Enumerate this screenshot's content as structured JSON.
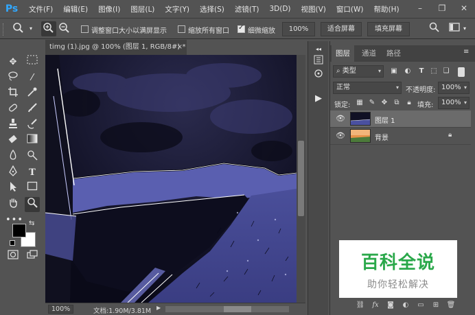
{
  "app": {
    "logo": "Ps"
  },
  "menu": [
    "文件(F)",
    "编辑(E)",
    "图像(I)",
    "图层(L)",
    "文字(Y)",
    "选择(S)",
    "滤镜(T)",
    "3D(D)",
    "视图(V)",
    "窗口(W)",
    "帮助(H)"
  ],
  "options": {
    "resize_windows_label": "调整窗口大小以满屏显示",
    "zoom_all_label": "缩放所有窗口",
    "scrubby_zoom_label": "细微缩放",
    "scrubby_zoom_checked": true,
    "zoom_value": "100%",
    "fit_screen_label": "适合屏幕",
    "fill_screen_label": "填充屏幕"
  },
  "document": {
    "tab_title": "timg (1).jpg @ 100% (图层 1, RGB/8#) *",
    "close_glyph": "×",
    "zoom": "100%",
    "doc_size": "文档:1.90M/3.81M"
  },
  "layers_panel": {
    "tabs": [
      "图层",
      "通道",
      "路径"
    ],
    "filter_kind": "类型",
    "blend_mode": "正常",
    "opacity_label": "不透明度:",
    "opacity_value": "100%",
    "lock_label": "锁定:",
    "fill_label": "填充:",
    "fill_value": "100%",
    "layers": [
      {
        "name": "图层 1",
        "selected": true,
        "locked": false
      },
      {
        "name": "背景",
        "selected": false,
        "locked": true
      }
    ]
  },
  "watermark": {
    "title": "百科全说",
    "subtitle": "助你轻松解决"
  },
  "colors": {
    "accent": "#31a8ff",
    "watermark_green": "#2aa84a",
    "panel_bg": "#535353"
  }
}
